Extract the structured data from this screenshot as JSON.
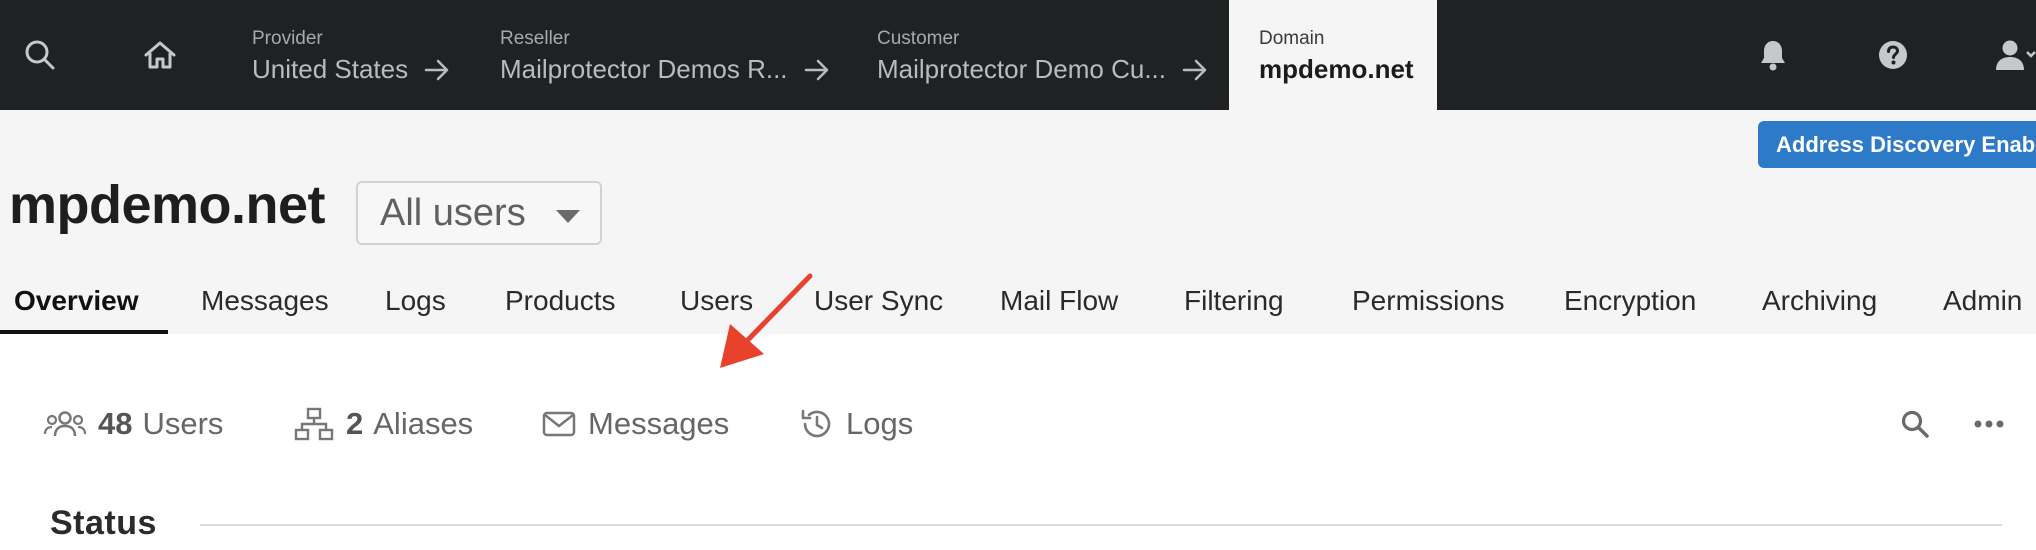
{
  "topbar": {
    "breadcrumbs": [
      {
        "label": "Provider",
        "value": "United States"
      },
      {
        "label": "Reseller",
        "value": "Mailprotector Demos R..."
      },
      {
        "label": "Customer",
        "value": "Mailprotector Demo Cu..."
      },
      {
        "label": "Domain",
        "value": "mpdemo.net"
      }
    ],
    "icons": [
      "search-icon",
      "home-icon",
      "bell-icon",
      "help-icon",
      "user-icon"
    ]
  },
  "header": {
    "discovery_button": "Address Discovery Enabled",
    "domain_title": "mpdemo.net",
    "scope_select": "All users"
  },
  "tabs": [
    {
      "label": "Overview",
      "active": true
    },
    {
      "label": "Messages"
    },
    {
      "label": "Logs"
    },
    {
      "label": "Products"
    },
    {
      "label": "Users"
    },
    {
      "label": "User Sync"
    },
    {
      "label": "Mail Flow"
    },
    {
      "label": "Filtering"
    },
    {
      "label": "Permissions"
    },
    {
      "label": "Encryption"
    },
    {
      "label": "Archiving"
    },
    {
      "label": "Admin"
    }
  ],
  "stats": {
    "users": {
      "count": "48",
      "label": "Users",
      "icon": "users-icon"
    },
    "aliases": {
      "count": "2",
      "label": "Aliases",
      "icon": "sitemap-icon"
    },
    "messages": {
      "label": "Messages",
      "icon": "envelope-icon"
    },
    "logs": {
      "label": "Logs",
      "icon": "history-icon"
    }
  },
  "status": {
    "title": "Status"
  },
  "colors": {
    "topbar": "#202122",
    "header_bg": "#f5f5f5",
    "accent_blue": "#2d7ac8",
    "annotation_red": "#e8412c"
  }
}
